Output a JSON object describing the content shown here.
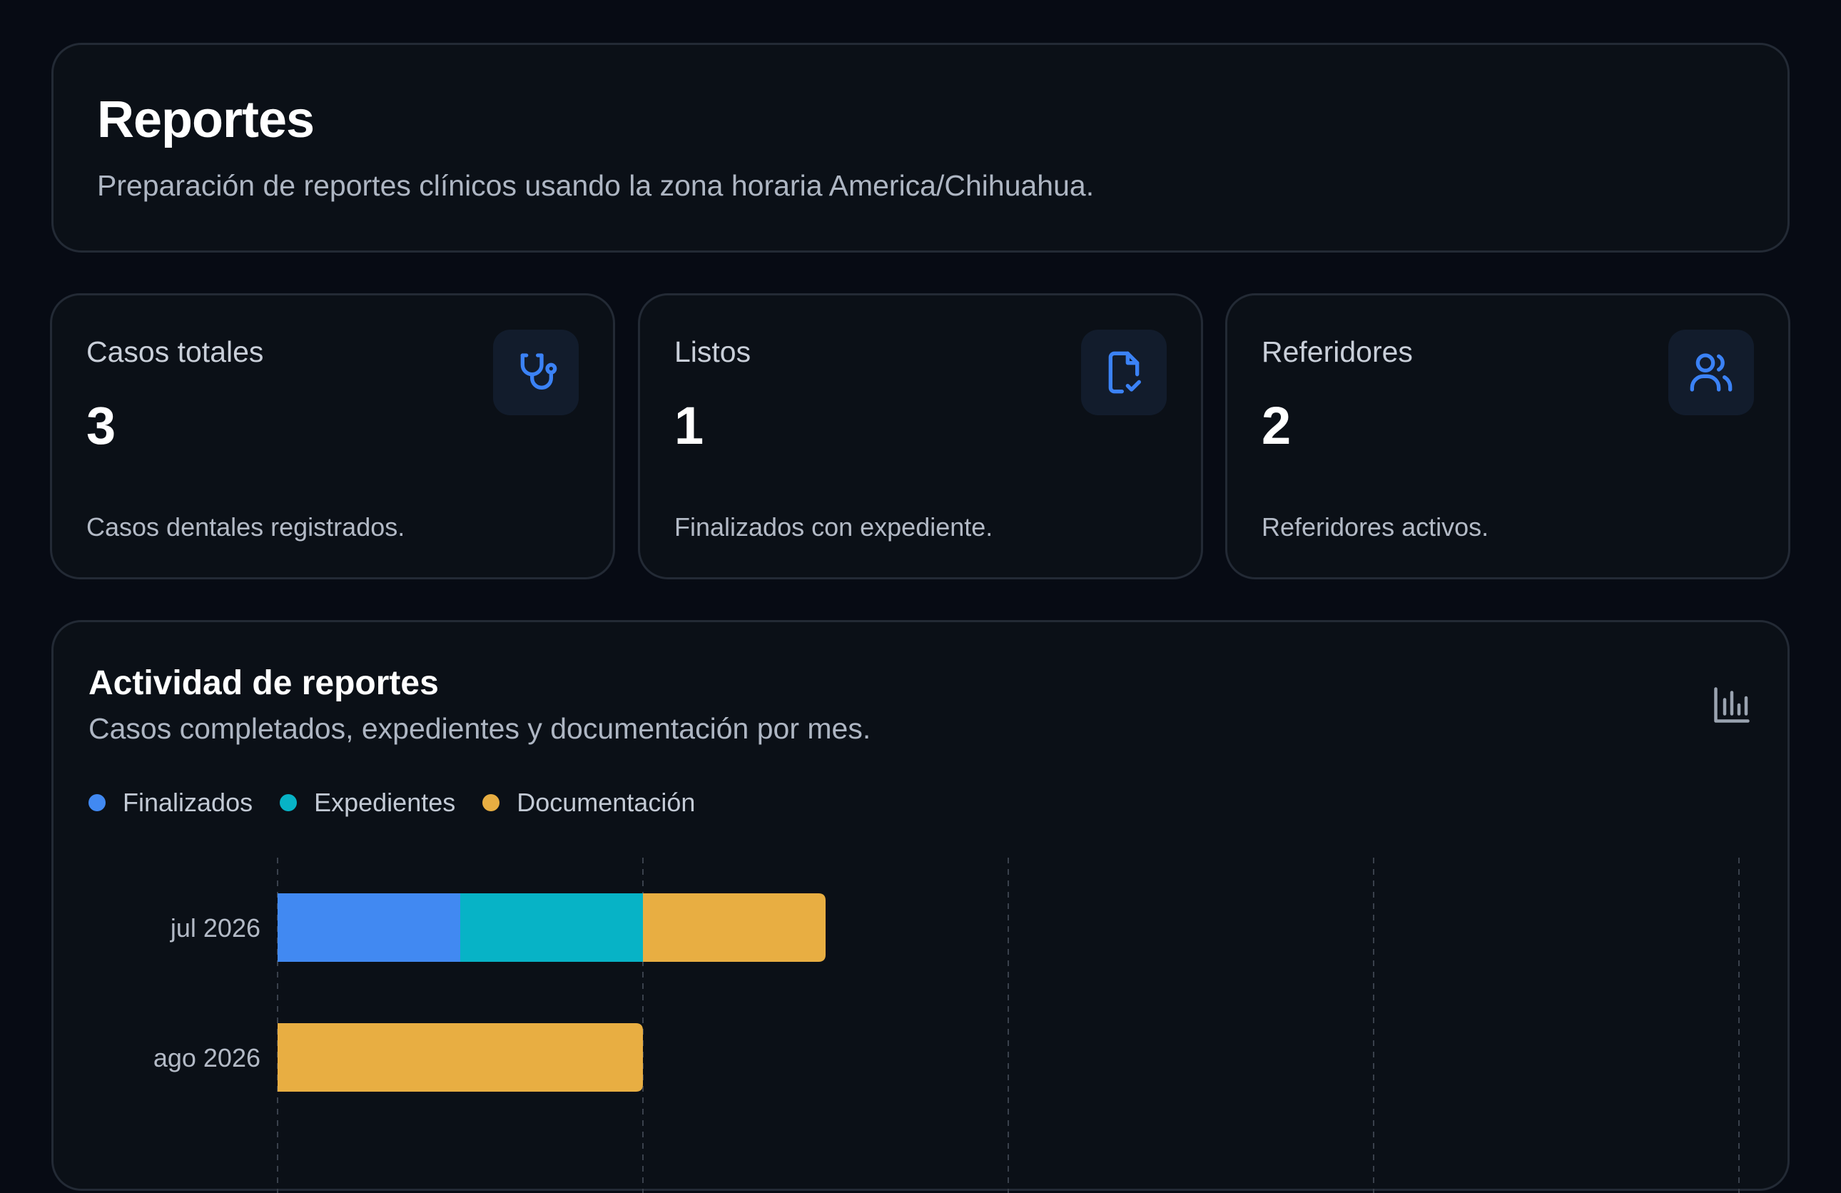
{
  "header": {
    "title": "Reportes",
    "subtitle": "Preparación de reportes clínicos usando la zona horaria America/Chihuahua."
  },
  "stats": [
    {
      "label": "Casos totales",
      "value": "3",
      "description": "Casos dentales registrados.",
      "icon": "stethoscope-icon"
    },
    {
      "label": "Listos",
      "value": "1",
      "description": "Finalizados con expediente.",
      "icon": "file-check-icon"
    },
    {
      "label": "Referidores",
      "value": "2",
      "description": "Referidores activos.",
      "icon": "users-icon"
    }
  ],
  "chart": {
    "title": "Actividad de reportes",
    "subtitle": "Casos completados, expedientes y documentación por mes.",
    "menu_icon": "bar-chart-icon"
  },
  "colors": {
    "finalizados": "#4189f2",
    "expedientes": "#07b3c6",
    "documentacion": "#e8ae42",
    "accent_icon": "#3b82f6"
  },
  "chart_data": {
    "type": "bar",
    "orientation": "horizontal",
    "stacked": true,
    "categories": [
      "jul 2026",
      "ago 2026"
    ],
    "series": [
      {
        "name": "Finalizados",
        "values": [
          1,
          0
        ]
      },
      {
        "name": "Expedientes",
        "values": [
          1,
          0
        ]
      },
      {
        "name": "Documentación",
        "values": [
          1,
          2
        ]
      }
    ],
    "xlim": [
      0,
      8
    ],
    "grid": true,
    "legend": "top-left"
  }
}
